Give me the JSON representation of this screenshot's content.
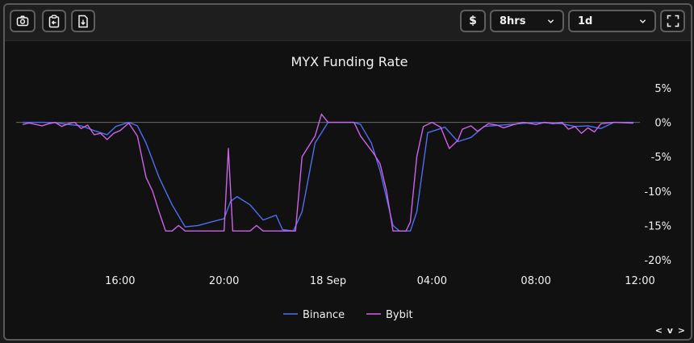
{
  "toolbar": {
    "currency_label": "$",
    "interval_value": "8hrs",
    "range_value": "1d"
  },
  "colors": {
    "binance": "#4f6ff0",
    "bybit": "#cc63e8",
    "background": "#111111",
    "zero_line": "#6a6a6a"
  },
  "icons": [
    "camera-icon",
    "clipboard-copy-icon",
    "download-file-icon",
    "chevron-down-icon",
    "fullscreen-icon"
  ],
  "chart_data": {
    "type": "line",
    "title": "MYX Funding Rate",
    "xlabel": "",
    "ylabel": "",
    "y_unit": "%",
    "ylim": [
      -20,
      5
    ],
    "y_ticks": [
      5,
      0,
      -5,
      -10,
      -15,
      -20
    ],
    "y_tick_labels": [
      "5%",
      "0%",
      "-5%",
      "-10%",
      "-15%",
      "-20%"
    ],
    "x_range": [
      "17 Sep 12:00",
      "18 Sep 12:00"
    ],
    "x_ticks": [
      "17 Sep 16:00",
      "17 Sep 20:00",
      "18 Sep 00:00",
      "18 Sep 04:00",
      "18 Sep 08:00",
      "18 Sep 12:00"
    ],
    "x_tick_labels": [
      "16:00",
      "20:00",
      "18 Sep",
      "04:00",
      "08:00",
      "12:00"
    ],
    "zero_line": true,
    "legend": "bottom-center",
    "series": [
      {
        "name": "Binance",
        "color": "#4f6ff0",
        "points": [
          [
            "17 Sep 12:15",
            0
          ],
          [
            "17 Sep 13:00",
            0
          ],
          [
            "17 Sep 13:30",
            -0.05
          ],
          [
            "17 Sep 14:00",
            -0.3
          ],
          [
            "17 Sep 14:30",
            -0.5
          ],
          [
            "17 Sep 15:00",
            -1.2
          ],
          [
            "17 Sep 15:30",
            -1.8
          ],
          [
            "17 Sep 15:50",
            -0.6
          ],
          [
            "17 Sep 16:20",
            0
          ],
          [
            "17 Sep 16:40",
            -0.5
          ],
          [
            "17 Sep 17:00",
            -3
          ],
          [
            "17 Sep 17:30",
            -8
          ],
          [
            "17 Sep 18:00",
            -12
          ],
          [
            "17 Sep 18:30",
            -15.2
          ],
          [
            "17 Sep 19:00",
            -15
          ],
          [
            "17 Sep 19:30",
            -14.5
          ],
          [
            "17 Sep 20:00",
            -14
          ],
          [
            "17 Sep 20:15",
            -11.5
          ],
          [
            "17 Sep 20:30",
            -10.8
          ],
          [
            "17 Sep 21:00",
            -12
          ],
          [
            "17 Sep 21:30",
            -14.2
          ],
          [
            "17 Sep 22:00",
            -13.5
          ],
          [
            "17 Sep 22:15",
            -15.6
          ],
          [
            "17 Sep 22:40",
            -15.8
          ],
          [
            "17 Sep 23:00",
            -13
          ],
          [
            "17 Sep 23:30",
            -3
          ],
          [
            "18 Sep 00:00",
            0
          ],
          [
            "18 Sep 00:30",
            0
          ],
          [
            "18 Sep 01:00",
            0
          ],
          [
            "18 Sep 01:15",
            -0.3
          ],
          [
            "18 Sep 01:40",
            -3
          ],
          [
            "18 Sep 02:00",
            -7
          ],
          [
            "18 Sep 02:15",
            -11
          ],
          [
            "18 Sep 02:30",
            -15
          ],
          [
            "18 Sep 02:45",
            -15.8
          ],
          [
            "18 Sep 03:10",
            -15.8
          ],
          [
            "18 Sep 03:25",
            -13
          ],
          [
            "18 Sep 03:50",
            -1.5
          ],
          [
            "18 Sep 04:30",
            -0.7
          ],
          [
            "18 Sep 05:00",
            -2.8
          ],
          [
            "18 Sep 05:30",
            -2.2
          ],
          [
            "18 Sep 06:00",
            -0.6
          ],
          [
            "18 Sep 07:00",
            -0.3
          ],
          [
            "18 Sep 08:00",
            0
          ],
          [
            "18 Sep 09:00",
            -0.2
          ],
          [
            "18 Sep 09:30",
            -0.6
          ],
          [
            "18 Sep 10:00",
            -0.5
          ],
          [
            "18 Sep 10:30",
            -0.9
          ],
          [
            "18 Sep 11:00",
            0
          ],
          [
            "18 Sep 11:45",
            0
          ]
        ]
      },
      {
        "name": "Bybit",
        "color": "#cc63e8",
        "points": [
          [
            "17 Sep 12:15",
            -0.3
          ],
          [
            "17 Sep 12:30",
            -0.1
          ],
          [
            "17 Sep 12:45",
            -0.3
          ],
          [
            "17 Sep 13:00",
            -0.5
          ],
          [
            "17 Sep 13:15",
            -0.2
          ],
          [
            "17 Sep 13:30",
            0
          ],
          [
            "17 Sep 13:45",
            -0.6
          ],
          [
            "17 Sep 14:00",
            -0.2
          ],
          [
            "17 Sep 14:15",
            0
          ],
          [
            "17 Sep 14:30",
            -0.9
          ],
          [
            "17 Sep 14:45",
            -0.4
          ],
          [
            "17 Sep 15:00",
            -1.8
          ],
          [
            "17 Sep 15:15",
            -1.6
          ],
          [
            "17 Sep 15:30",
            -2.5
          ],
          [
            "17 Sep 15:45",
            -1.6
          ],
          [
            "17 Sep 16:00",
            -1.2
          ],
          [
            "17 Sep 16:20",
            -0.1
          ],
          [
            "17 Sep 16:40",
            -2
          ],
          [
            "17 Sep 17:00",
            -8
          ],
          [
            "17 Sep 17:15",
            -10
          ],
          [
            "17 Sep 17:30",
            -13
          ],
          [
            "17 Sep 17:45",
            -15.8
          ],
          [
            "17 Sep 18:00",
            -15.8
          ],
          [
            "17 Sep 18:15",
            -15
          ],
          [
            "17 Sep 18:30",
            -15.8
          ],
          [
            "17 Sep 19:00",
            -15.8
          ],
          [
            "17 Sep 20:00",
            -15.8
          ],
          [
            "17 Sep 20:10",
            -3.8
          ],
          [
            "17 Sep 20:20",
            -15.8
          ],
          [
            "17 Sep 21:00",
            -15.8
          ],
          [
            "17 Sep 21:15",
            -15
          ],
          [
            "17 Sep 21:30",
            -15.8
          ],
          [
            "17 Sep 22:00",
            -15.8
          ],
          [
            "17 Sep 22:45",
            -15.8
          ],
          [
            "17 Sep 23:00",
            -5
          ],
          [
            "17 Sep 23:30",
            -2
          ],
          [
            "17 Sep 23:45",
            1.2
          ],
          [
            "18 Sep 00:00",
            0
          ],
          [
            "18 Sep 01:00",
            0
          ],
          [
            "18 Sep 01:15",
            -2
          ],
          [
            "18 Sep 01:45",
            -4.5
          ],
          [
            "18 Sep 02:00",
            -6
          ],
          [
            "18 Sep 02:15",
            -10
          ],
          [
            "18 Sep 02:30",
            -15.8
          ],
          [
            "18 Sep 03:00",
            -15.8
          ],
          [
            "18 Sep 03:10",
            -14.5
          ],
          [
            "18 Sep 03:25",
            -5
          ],
          [
            "18 Sep 03:40",
            -0.6
          ],
          [
            "18 Sep 04:00",
            0
          ],
          [
            "18 Sep 04:20",
            -0.7
          ],
          [
            "18 Sep 04:40",
            -3.8
          ],
          [
            "18 Sep 05:00",
            -2.6
          ],
          [
            "18 Sep 05:10",
            -1
          ],
          [
            "18 Sep 05:30",
            -0.5
          ],
          [
            "18 Sep 05:45",
            -1.3
          ],
          [
            "18 Sep 06:10",
            -0.2
          ],
          [
            "18 Sep 06:30",
            -0.4
          ],
          [
            "18 Sep 06:45",
            -0.8
          ],
          [
            "18 Sep 07:10",
            -0.3
          ],
          [
            "18 Sep 07:30",
            0
          ],
          [
            "18 Sep 08:00",
            -0.3
          ],
          [
            "18 Sep 08:20",
            0
          ],
          [
            "18 Sep 08:40",
            -0.2
          ],
          [
            "18 Sep 09:00",
            0
          ],
          [
            "18 Sep 09:15",
            -1
          ],
          [
            "18 Sep 09:30",
            -0.6
          ],
          [
            "18 Sep 09:45",
            -1.6
          ],
          [
            "18 Sep 10:00",
            -0.8
          ],
          [
            "18 Sep 10:15",
            -1.4
          ],
          [
            "18 Sep 10:30",
            -0.2
          ],
          [
            "18 Sep 11:00",
            0
          ],
          [
            "18 Sep 11:45",
            -0.1
          ]
        ]
      }
    ]
  },
  "footer": {
    "scroll_hint": "< v >"
  }
}
